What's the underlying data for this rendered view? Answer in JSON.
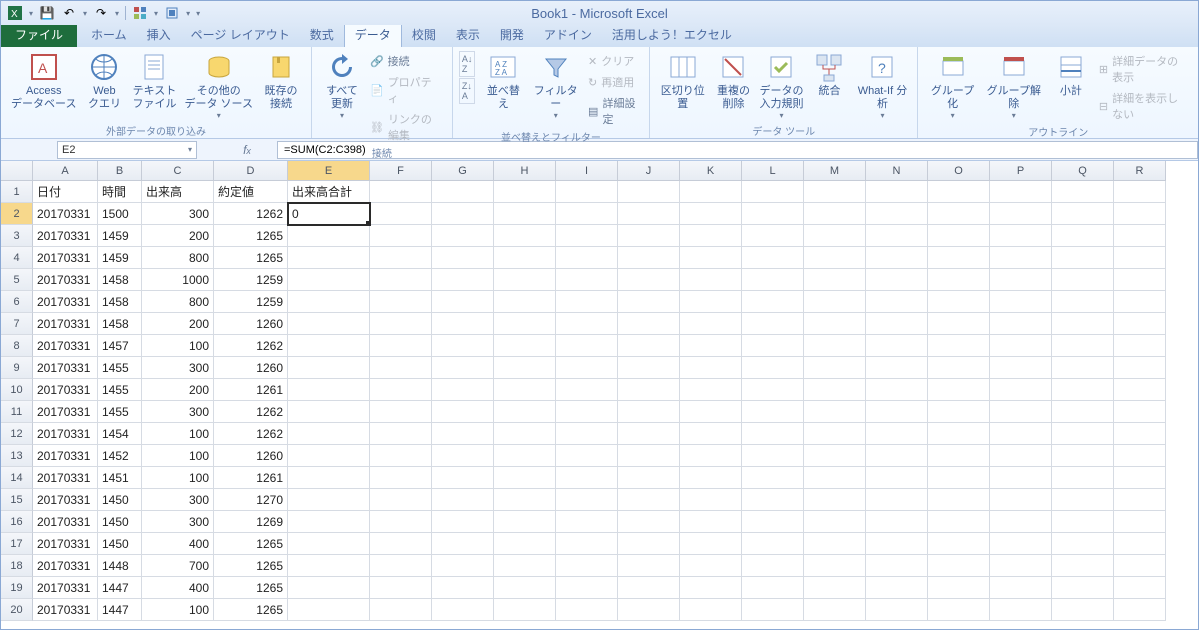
{
  "app_title": "Book1 - Microsoft Excel",
  "qat": {
    "save": "💾",
    "undo": "↶",
    "redo": "↷"
  },
  "tabs": {
    "file": "ファイル",
    "home": "ホーム",
    "insert": "挿入",
    "pagelayout": "ページ レイアウト",
    "formulas": "数式",
    "data": "データ",
    "review": "校閲",
    "view": "表示",
    "developer": "開発",
    "addins": "アドイン",
    "utilize": "活用しよう！エクセル"
  },
  "ribbon": {
    "get_external": {
      "access": "Access\nデータベース",
      "web": "Web\nクエリ",
      "text": "テキスト\nファイル",
      "other": "その他の\nデータ ソース",
      "existing": "既存の\n接続",
      "group": "外部データの取り込み"
    },
    "connections": {
      "refresh": "すべて\n更新",
      "conn": "接続",
      "prop": "プロパティ",
      "editlinks": "リンクの編集",
      "group": "接続"
    },
    "sort": {
      "az": "A→Z",
      "za": "Z→A",
      "sort": "並べ替え",
      "filter": "フィルター",
      "clear": "クリア",
      "reapply": "再適用",
      "advanced": "詳細設定",
      "group": "並べ替えとフィルター"
    },
    "datatools": {
      "texttocols": "区切り位置",
      "removedup": "重複の\n削除",
      "validation": "データの\n入力規則",
      "consolidate": "統合",
      "whatif": "What-If 分析",
      "group": "データ ツール"
    },
    "outline": {
      "groupbtn": "グループ化",
      "ungroup": "グループ解除",
      "subtotal": "小計",
      "showdetail": "詳細データの表示",
      "hidedetail": "詳細を表示しない",
      "group": "アウトライン"
    }
  },
  "namebox": "E2",
  "formula": "=SUM(C2:C398)",
  "columns": [
    "A",
    "B",
    "C",
    "D",
    "E",
    "F",
    "G",
    "H",
    "I",
    "J",
    "K",
    "L",
    "M",
    "N",
    "O",
    "P",
    "Q",
    "R"
  ],
  "headers": {
    "A": "日付",
    "B": "時間",
    "C": "出来高",
    "D": "約定値",
    "E": "出来高合計"
  },
  "rows": [
    {
      "n": 2,
      "A": "20170331",
      "B": "1500",
      "C": "300",
      "D": "1262",
      "E": "0"
    },
    {
      "n": 3,
      "A": "20170331",
      "B": "1459",
      "C": "200",
      "D": "1265"
    },
    {
      "n": 4,
      "A": "20170331",
      "B": "1459",
      "C": "800",
      "D": "1265"
    },
    {
      "n": 5,
      "A": "20170331",
      "B": "1458",
      "C": "1000",
      "D": "1259"
    },
    {
      "n": 6,
      "A": "20170331",
      "B": "1458",
      "C": "800",
      "D": "1259"
    },
    {
      "n": 7,
      "A": "20170331",
      "B": "1458",
      "C": "200",
      "D": "1260"
    },
    {
      "n": 8,
      "A": "20170331",
      "B": "1457",
      "C": "100",
      "D": "1262"
    },
    {
      "n": 9,
      "A": "20170331",
      "B": "1455",
      "C": "300",
      "D": "1260"
    },
    {
      "n": 10,
      "A": "20170331",
      "B": "1455",
      "C": "200",
      "D": "1261"
    },
    {
      "n": 11,
      "A": "20170331",
      "B": "1455",
      "C": "300",
      "D": "1262"
    },
    {
      "n": 12,
      "A": "20170331",
      "B": "1454",
      "C": "100",
      "D": "1262"
    },
    {
      "n": 13,
      "A": "20170331",
      "B": "1452",
      "C": "100",
      "D": "1260"
    },
    {
      "n": 14,
      "A": "20170331",
      "B": "1451",
      "C": "100",
      "D": "1261"
    },
    {
      "n": 15,
      "A": "20170331",
      "B": "1450",
      "C": "300",
      "D": "1270"
    },
    {
      "n": 16,
      "A": "20170331",
      "B": "1450",
      "C": "300",
      "D": "1269"
    },
    {
      "n": 17,
      "A": "20170331",
      "B": "1450",
      "C": "400",
      "D": "1265"
    },
    {
      "n": 18,
      "A": "20170331",
      "B": "1448",
      "C": "700",
      "D": "1265"
    },
    {
      "n": 19,
      "A": "20170331",
      "B": "1447",
      "C": "400",
      "D": "1265"
    },
    {
      "n": 20,
      "A": "20170331",
      "B": "1447",
      "C": "100",
      "D": "1265"
    }
  ],
  "selected": {
    "row": 2,
    "col": "E"
  }
}
